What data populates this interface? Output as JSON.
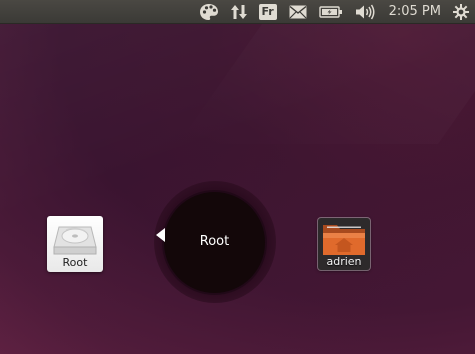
{
  "panel": {
    "indicators": [
      {
        "name": "palette-icon"
      },
      {
        "name": "network-transfer-icon"
      },
      {
        "name": "keyboard-layout",
        "label": "Fr"
      },
      {
        "name": "mail-icon"
      },
      {
        "name": "battery-icon"
      },
      {
        "name": "volume-icon"
      }
    ],
    "clock": "2:05 PM",
    "session_icon": "power-gear-icon"
  },
  "desktop": {
    "left_item": {
      "label": "Root",
      "icon": "harddisk-icon"
    },
    "center_item": {
      "label": "Root"
    },
    "right_item": {
      "label": "adrien",
      "icon": "home-folder-icon"
    }
  },
  "colors": {
    "panel_bg": "#3b3a36",
    "panel_text": "#dfdbd2",
    "desktop_bg": "#3d1530",
    "folder_orange": "#e06a2c",
    "pie_center": "#130709"
  }
}
